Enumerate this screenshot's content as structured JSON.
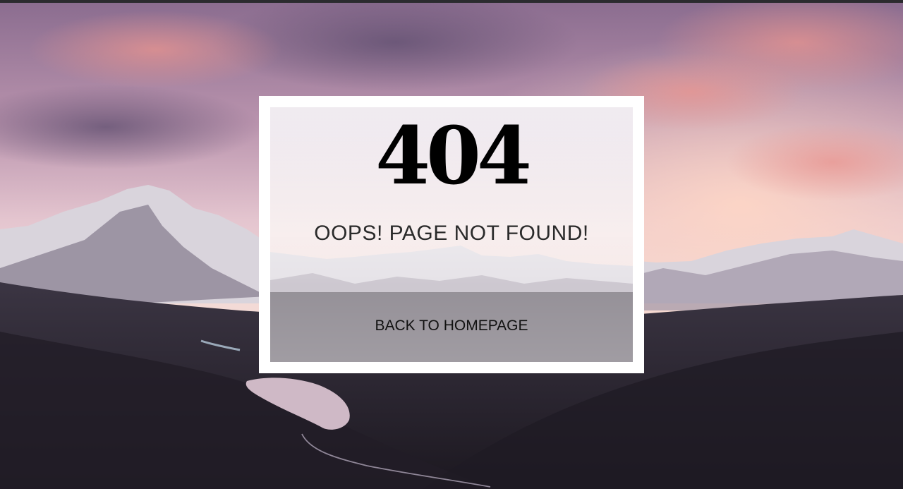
{
  "error": {
    "code": "404",
    "message": "OOPS! PAGE NOT FOUND!",
    "back_link_label": "BACK TO HOMEPAGE"
  },
  "colors": {
    "frame_border": "#ffffff",
    "code_text": "#000000",
    "message_text": "#2a2a2a",
    "link_text": "#111111"
  }
}
